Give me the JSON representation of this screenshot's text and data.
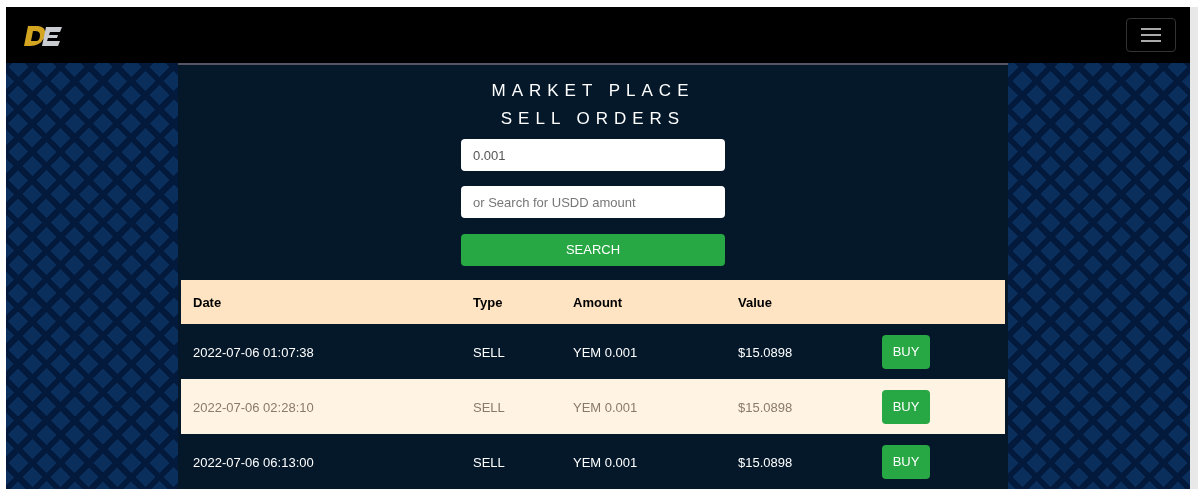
{
  "title_lines": [
    "MARKET PLACE",
    "SELL ORDERS"
  ],
  "amount_field": {
    "value": "0.001"
  },
  "usdd_field": {
    "placeholder": "or Search for USDD amount"
  },
  "search_button": "SEARCH",
  "table": {
    "columns": [
      "Date",
      "Type",
      "Amount",
      "Value"
    ],
    "rows": [
      {
        "cells": [
          "2022-07-06 01:07:38",
          "SELL",
          "YEM 0.001",
          "$15.0898"
        ],
        "action": "BUY"
      },
      {
        "cells": [
          "2022-07-06 02:28:10",
          "SELL",
          "YEM 0.001",
          "$15.0898"
        ],
        "action": "BUY"
      },
      {
        "cells": [
          "2022-07-06 06:13:00",
          "SELL",
          "YEM 0.001",
          "$15.0898"
        ],
        "action": "BUY"
      }
    ]
  }
}
